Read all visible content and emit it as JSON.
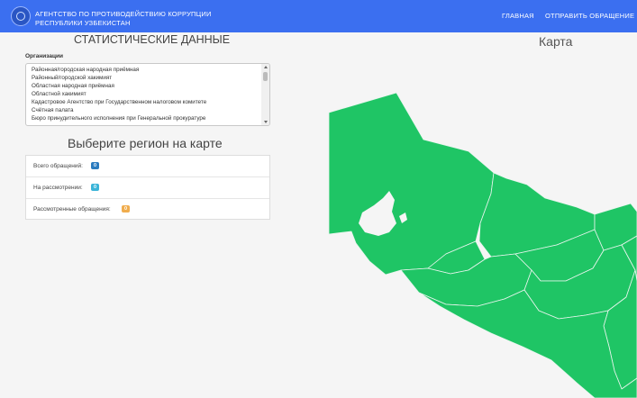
{
  "header": {
    "brand_line1": "АГЕНТСТВО ПО ПРОТИВОДЕЙСТВИЮ КОРРУПЦИИ",
    "brand_line2": "РЕСПУБЛИКИ УЗБЕКИСТАН",
    "nav_home": "ГЛАВНАЯ",
    "nav_send": "ОТПРАВИТЬ ОБРАЩЕНИЕ"
  },
  "stats": {
    "title": "СТАТИСТИЧЕСКИЕ ДАННЫЕ",
    "org_label": "Организации",
    "organizations": [
      "Районная/городская народная приёмная",
      "Районный/городской хакимият",
      "Областная народная приёмная",
      "Областной хакимият",
      "Кадастровое Агентство при Государственном налоговом комитете",
      "Счётная палата",
      "Бюро принудительного исполнения при Генеральной прокуратуре"
    ]
  },
  "region": {
    "title": "Выберите регион на карте",
    "rows": [
      {
        "label": "Всего обращений:",
        "count": "0",
        "color": "#2a7bbf"
      },
      {
        "label": "На рассмотрении:",
        "count": "0",
        "color": "#3bb4d8"
      },
      {
        "label": "Рассмотренные обращения:",
        "count": "0",
        "color": "#f0ad4e"
      }
    ]
  },
  "map": {
    "title": "Карта",
    "fill": "#1fc565",
    "border": "#e9f5ee"
  }
}
